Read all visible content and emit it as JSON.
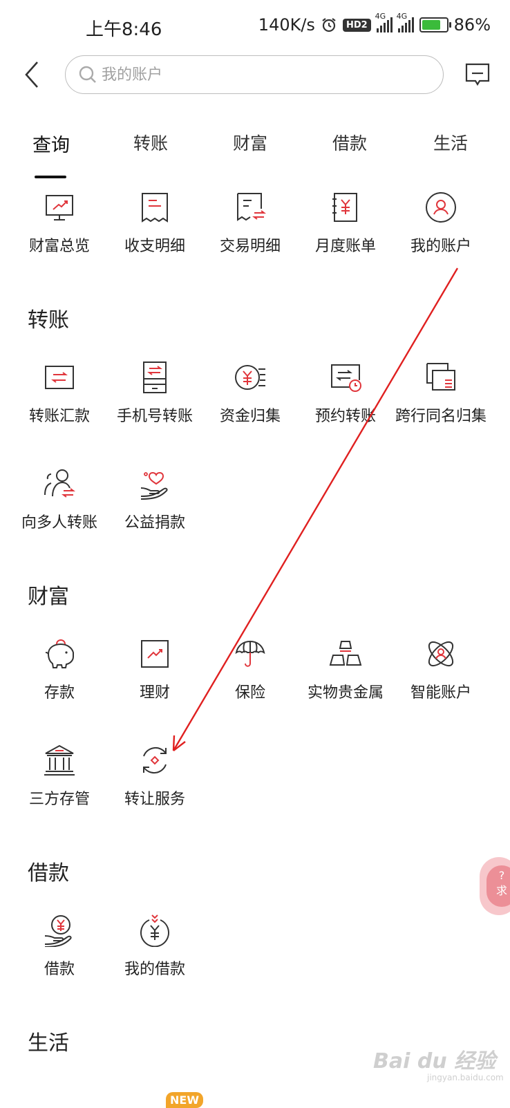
{
  "status": {
    "time": "上午8:46",
    "speed": "140K/s",
    "hd": "HD2",
    "net1": "4G",
    "net2": "4G",
    "battery": "86%",
    "battery_level": 0.86
  },
  "search": {
    "placeholder": "我的账户"
  },
  "tabs": [
    {
      "label": "查询",
      "active": true
    },
    {
      "label": "转账"
    },
    {
      "label": "财富"
    },
    {
      "label": "借款"
    },
    {
      "label": "生活"
    }
  ],
  "query": {
    "items": [
      {
        "label": "财富总览",
        "icon": "monitor-chart-icon"
      },
      {
        "label": "收支明细",
        "icon": "receipt-icon"
      },
      {
        "label": "交易明细",
        "icon": "receipt-exchange-icon"
      },
      {
        "label": "月度账单",
        "icon": "yuan-notebook-icon"
      },
      {
        "label": "我的账户",
        "icon": "user-circle-icon"
      }
    ]
  },
  "transfer": {
    "title": "转账",
    "items": [
      {
        "label": "转账汇款",
        "icon": "transfer-card-icon"
      },
      {
        "label": "手机号转账",
        "icon": "phone-transfer-icon"
      },
      {
        "label": "资金归集",
        "icon": "yuan-collect-icon"
      },
      {
        "label": "预约转账",
        "icon": "scheduled-transfer-icon"
      },
      {
        "label": "跨行同名归集",
        "icon": "cross-bank-icon"
      },
      {
        "label": "向多人转账",
        "icon": "multi-person-icon"
      },
      {
        "label": "公益捐款",
        "icon": "charity-heart-icon"
      }
    ]
  },
  "wealth": {
    "title": "财富",
    "items": [
      {
        "label": "存款",
        "icon": "piggy-bank-icon"
      },
      {
        "label": "理财",
        "icon": "finance-chart-icon"
      },
      {
        "label": "保险",
        "icon": "umbrella-icon"
      },
      {
        "label": "实物贵金属",
        "icon": "gold-bars-icon"
      },
      {
        "label": "智能账户",
        "icon": "atom-user-icon"
      },
      {
        "label": "三方存管",
        "icon": "bank-building-icon"
      },
      {
        "label": "转让服务",
        "icon": "transfer-cycle-icon"
      }
    ]
  },
  "loan": {
    "title": "借款",
    "items": [
      {
        "label": "借款",
        "icon": "yuan-hand-icon"
      },
      {
        "label": "我的借款",
        "icon": "my-loan-icon"
      }
    ]
  },
  "life": {
    "title": "生活",
    "new_badge": "NEW"
  },
  "help_float": {
    "text": "求"
  },
  "watermark": {
    "text": "Bai du 经验",
    "sub": "jingyan.baidu.com"
  },
  "colors": {
    "accent": "#e0353b",
    "text": "#222222",
    "annotation": "#e02020"
  }
}
